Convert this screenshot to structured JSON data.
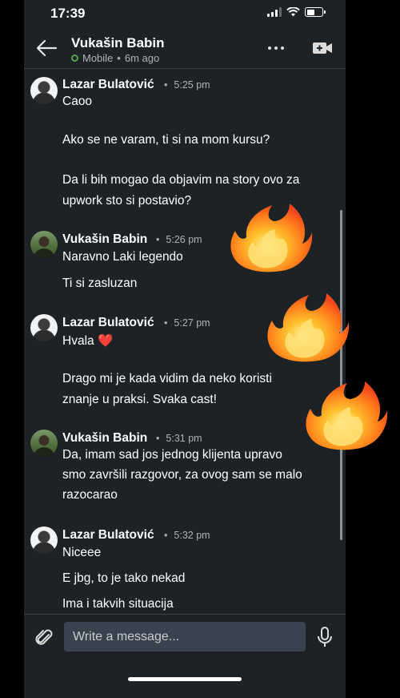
{
  "status_bar": {
    "time": "17:39"
  },
  "header": {
    "contact_name": "Vukašin Babin",
    "presence": "Mobile",
    "last_seen": "6m ago"
  },
  "messages": [
    {
      "sender": "Lazar Bulatović",
      "time": "5:25 pm",
      "lines": [
        "Caoo",
        "Ako se ne varam, ti si na mom kursu?",
        "Da li bih mogao da objavim na story ovo za",
        "upwork sto si postavio?"
      ]
    },
    {
      "sender": "Vukašin Babin",
      "time": "5:26 pm",
      "lines": [
        "Naravno Laki legendo",
        "Ti si zasluzan"
      ]
    },
    {
      "sender": "Lazar Bulatović",
      "time": "5:27 pm",
      "lines": [
        "Hvala",
        "Drago mi je kada vidim da neko koristi",
        "znanje u praksi. Svaka cast!"
      ],
      "emoji": "❤️"
    },
    {
      "sender": "Vukašin Babin",
      "time": "5:31 pm",
      "lines": [
        "Da, imam sad jos jednog klijenta upravo",
        "smo završili razgovor, za ovog sam se malo",
        "razocarao"
      ]
    },
    {
      "sender": "Lazar Bulatović",
      "time": "5:32 pm",
      "lines": [
        "Niceee",
        "E jbg, to je tako nekad",
        "Ima i takvih situacija"
      ]
    }
  ],
  "composer": {
    "placeholder": "Write a message..."
  },
  "colors": {
    "background": "#1d2226",
    "input": "#38434f",
    "online": "#57a54b",
    "muted_text": "#aeb3b8"
  },
  "icons": [
    "back-arrow-icon",
    "more-icon",
    "video-call-icon",
    "paperclip-icon",
    "microphone-icon",
    "fire-emoji"
  ]
}
